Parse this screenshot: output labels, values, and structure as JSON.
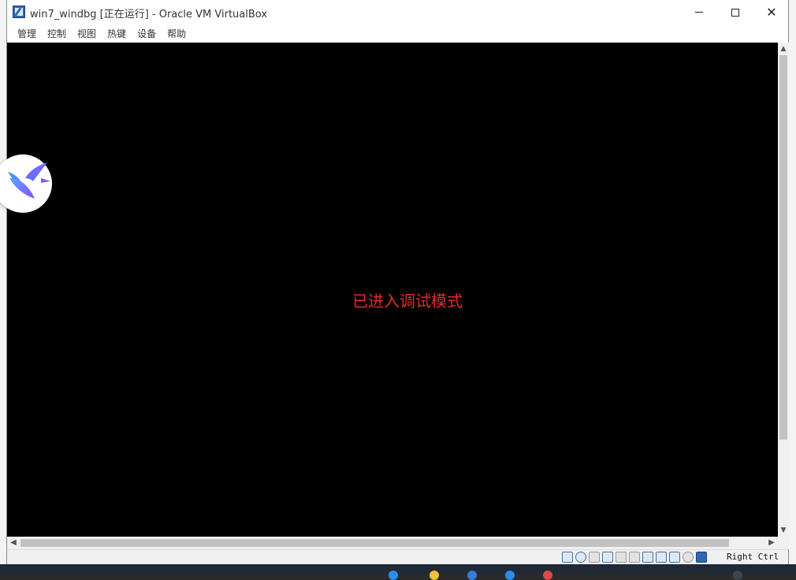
{
  "window": {
    "title": "win7_windbg [正在运行] - Oracle VM VirtualBox",
    "app_icon": "virtualbox-icon",
    "controls": [
      "minimize-icon",
      "maximize-icon",
      "close-icon"
    ]
  },
  "menubar": {
    "items": [
      {
        "label": "管理"
      },
      {
        "label": "控制"
      },
      {
        "label": "视图"
      },
      {
        "label": "热键"
      },
      {
        "label": "设备"
      },
      {
        "label": "帮助"
      }
    ]
  },
  "vm_screen": {
    "message": "已进入调试模式",
    "message_color": "#e8282a",
    "background": "#000000"
  },
  "statusbar": {
    "icons": [
      "hard-disk-icon",
      "optical-drive-icon",
      "audio-icon",
      "network-icon",
      "usb-icon",
      "shared-folders-icon",
      "display-icon",
      "video-capture-icon",
      "virtualization-icon",
      "mouse-integration-icon",
      "keyboard-icon"
    ],
    "host_key": "Right Ctrl"
  },
  "overlay": {
    "icon": "hummingbird-app-icon"
  }
}
